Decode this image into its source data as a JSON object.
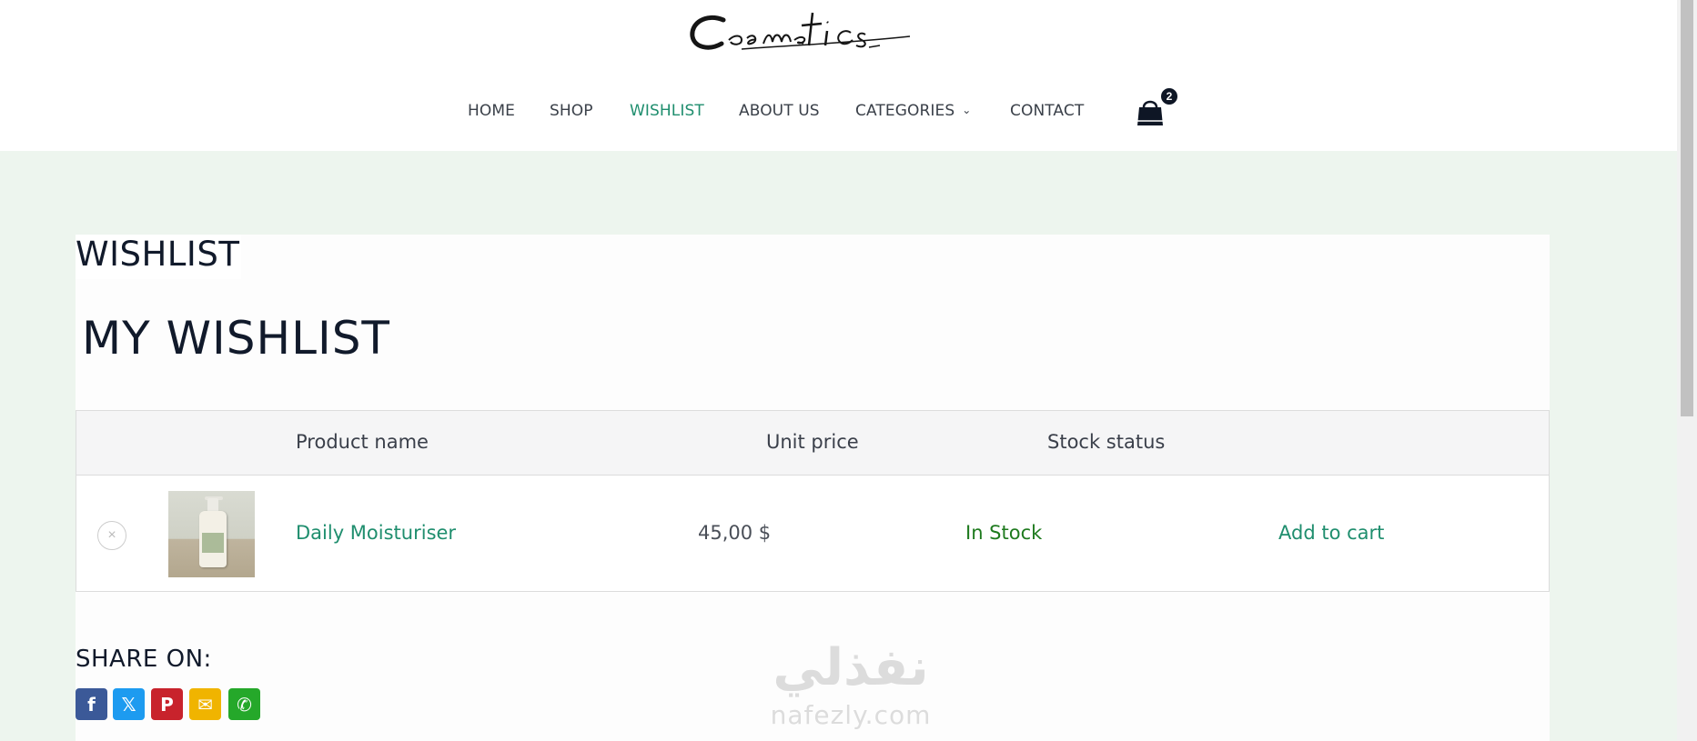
{
  "brand": {
    "logo_text": "Cosmetics"
  },
  "nav": {
    "items": [
      {
        "label": "HOME"
      },
      {
        "label": "SHOP"
      },
      {
        "label": "WISHLIST"
      },
      {
        "label": "ABOUT US"
      },
      {
        "label": "CATEGORIES"
      },
      {
        "label": "CONTACT"
      }
    ],
    "active_color": "#1f8e6e",
    "cart_count": "2"
  },
  "page": {
    "label": "WISHLIST",
    "title": "MY WISHLIST"
  },
  "table": {
    "columns": [
      "Product name",
      "Unit price",
      "Stock status"
    ],
    "rows": [
      {
        "remove_symbol": "×",
        "name": "Daily Moisturiser",
        "price": "45,00 $",
        "stock": "In Stock",
        "action": "Add to cart"
      }
    ]
  },
  "share": {
    "title": "SHARE ON:",
    "buttons": [
      {
        "name": "facebook",
        "glyph": "f",
        "color": "#3b5998"
      },
      {
        "name": "x",
        "glyph": "𝕏",
        "color": "#1d9bf0"
      },
      {
        "name": "pinterest",
        "glyph": "P",
        "color": "#c8232c"
      },
      {
        "name": "email",
        "glyph": "✉",
        "color": "#f0b400"
      },
      {
        "name": "whatsapp",
        "glyph": "✆",
        "color": "#25a82a"
      }
    ]
  },
  "watermark": {
    "arabic": "نفذلي",
    "latin": "nafezly.com"
  }
}
